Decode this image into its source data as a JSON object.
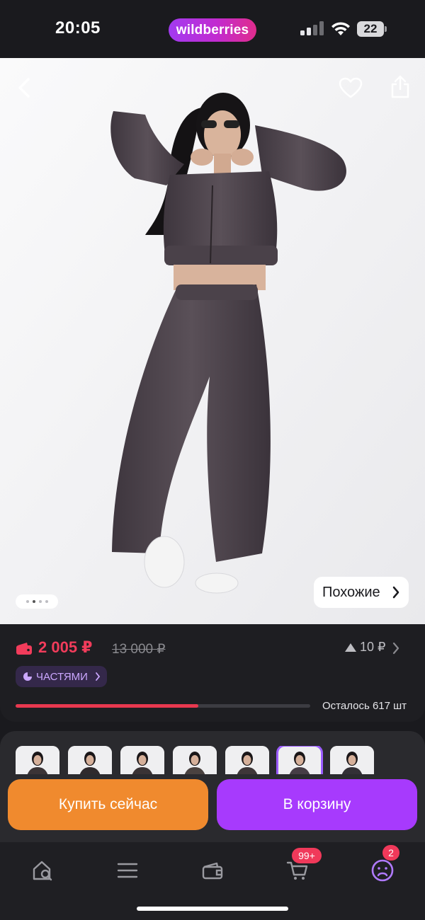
{
  "status_bar": {
    "time": "20:05",
    "brand": "wildberries",
    "battery": "22"
  },
  "photo": {
    "image_alt": "Woman in dark velour cropped zip hoodie and wide-leg pants",
    "similar_label": "Похожие",
    "dots_total": 4,
    "dots_active_index": 1
  },
  "price": {
    "current": "2 005 ₽",
    "old": "13 000 ₽",
    "change": "10 ₽",
    "installments_label": "ЧАСТЯМИ"
  },
  "stock": {
    "label": "Осталось 617 шт",
    "progress_fraction": 0.62
  },
  "thumbnails": {
    "count": 7,
    "selected_index": 5
  },
  "actions": {
    "buy_now": "Купить сейчас",
    "add_to_cart": "В корзину"
  },
  "tabbar": {
    "cart_badge": "99+",
    "profile_badge": "2"
  },
  "colors": {
    "accent_purple": "#a73afd",
    "accent_orange": "#f08a2e",
    "price_red": "#f23c5b",
    "brand_gradient_start": "#a23bf0",
    "brand_gradient_end": "#e02c8c"
  }
}
